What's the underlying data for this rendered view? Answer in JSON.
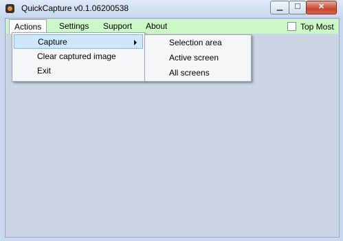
{
  "window": {
    "title": "QuickCapture v0.1.06200538",
    "accent_color": "#ccf7c6",
    "controls": {
      "minimize": "▁",
      "maximize": "☐",
      "close": "✕"
    }
  },
  "menubar": {
    "items": [
      {
        "label": "Actions",
        "state": "open"
      },
      {
        "label": "Settings"
      },
      {
        "label": "Support"
      },
      {
        "label": "About"
      }
    ],
    "top_most": {
      "label": "Top Most",
      "checked": false
    }
  },
  "actions_menu": {
    "items": [
      {
        "label": "Capture",
        "highlighted": true,
        "has_submenu": true
      },
      {
        "label": "Clear captured image"
      },
      {
        "label": "Exit"
      }
    ]
  },
  "capture_submenu": {
    "items": [
      {
        "label": "Selection area"
      },
      {
        "label": "Active screen"
      },
      {
        "label": "All screens"
      }
    ]
  }
}
